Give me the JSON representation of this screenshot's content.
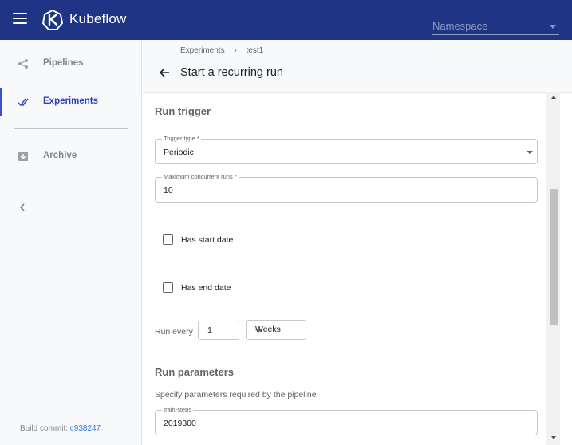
{
  "app": {
    "brand": "Kubeflow",
    "namespace_placeholder": "Namespace"
  },
  "sidebar": {
    "items": [
      {
        "label": "Pipelines",
        "icon": "pipelines-icon"
      },
      {
        "label": "Experiments",
        "icon": "experiments-icon",
        "active": true
      },
      {
        "label": "Archive",
        "icon": "archive-icon"
      }
    ],
    "build_label": "Build commit:",
    "build_commit": "c938247"
  },
  "header": {
    "breadcrumb": [
      "Experiments",
      "test1"
    ],
    "title": "Start a recurring run"
  },
  "form": {
    "run_trigger_heading": "Run trigger",
    "trigger_type": {
      "label": "Trigger type *",
      "value": "Periodic"
    },
    "max_concurrent": {
      "label": "Maximum concurrent runs *",
      "value": "10"
    },
    "has_start_date": {
      "label": "Has start date",
      "checked": false
    },
    "has_end_date": {
      "label": "Has end date",
      "checked": false
    },
    "run_every": {
      "label": "Run every",
      "value": "1",
      "unit": "Weeks"
    },
    "run_params_heading": "Run parameters",
    "run_params_desc": "Specify parameters required by the pipeline",
    "params": [
      {
        "label": "train-steps",
        "value": "2019300"
      }
    ]
  },
  "colors": {
    "topbar": "#1f3485",
    "accent": "#3b4fd1",
    "link": "#3b78e7"
  }
}
